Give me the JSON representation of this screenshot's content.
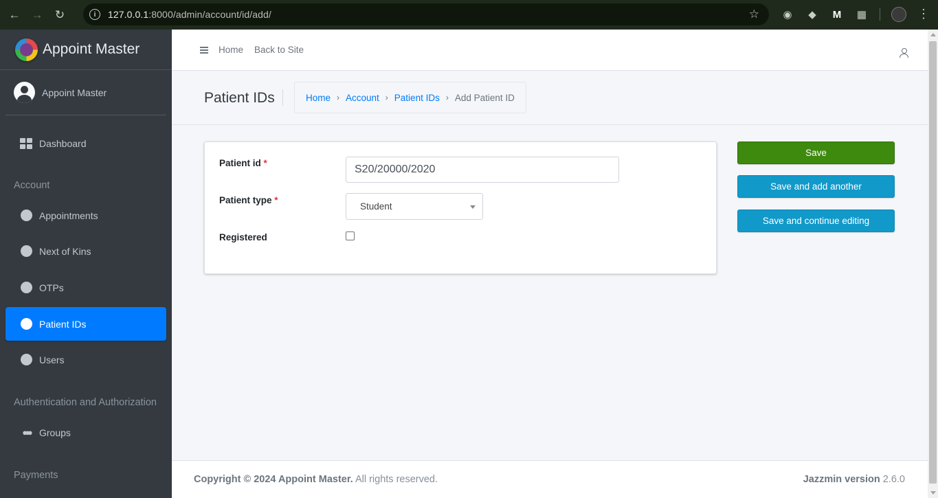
{
  "browser": {
    "url_host": "127.0.0.1",
    "url_rest": ":8000/admin/account/id/add/"
  },
  "sidebar": {
    "brand": "Appoint Master",
    "user": "Appoint Master",
    "items": [
      {
        "label": "Dashboard"
      },
      {
        "label": "Appointments"
      },
      {
        "label": "Next of Kins"
      },
      {
        "label": "OTPs"
      },
      {
        "label": "Patient IDs"
      },
      {
        "label": "Users"
      },
      {
        "label": "Groups"
      }
    ],
    "headers": [
      "Account",
      "Authentication and Authorization",
      "Payments"
    ]
  },
  "topnav": {
    "home": "Home",
    "back": "Back to Site"
  },
  "header": {
    "title": "Patient IDs",
    "breadcrumb": [
      "Home",
      "Account",
      "Patient IDs",
      "Add Patient ID"
    ]
  },
  "form": {
    "patient_id_label": "Patient id",
    "patient_id_value": "S20/20000/2020",
    "patient_type_label": "Patient type",
    "patient_type_value": "Student",
    "registered_label": "Registered",
    "required_mark": "*"
  },
  "buttons": {
    "save": "Save",
    "save_add": "Save and add another",
    "save_continue": "Save and continue editing"
  },
  "footer": {
    "copyright_bold": "Copyright © 2024 Appoint Master.",
    "copyright_rest": " All rights reserved.",
    "version_label": "Jazzmin version",
    "version_value": " 2.6.0"
  },
  "colors": {
    "sidebar": "#343a40",
    "active": "#007bff",
    "save": "#3d8a0e",
    "info": "#1199c9"
  }
}
